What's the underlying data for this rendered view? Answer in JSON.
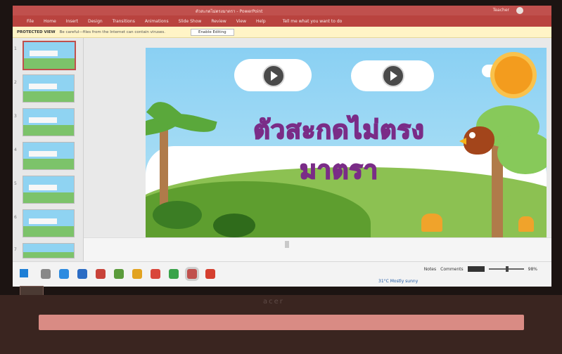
{
  "window": {
    "doc_title": "ตัวสะกดไม่ตรงมาตรา - PowerPoint",
    "user": "Teacher"
  },
  "ribbon": {
    "tabs": [
      "File",
      "Home",
      "Insert",
      "Design",
      "Transitions",
      "Animations",
      "Slide Show",
      "Review",
      "View",
      "Help"
    ],
    "tell_me": "Tell me what you want to do"
  },
  "notice": {
    "label": "PROTECTED VIEW",
    "message": "Be careful—files from the Internet can contain viruses.",
    "button": "Enable Editing"
  },
  "thumbnails": [
    {
      "num": "1"
    },
    {
      "num": "2"
    },
    {
      "num": "3"
    },
    {
      "num": "4"
    },
    {
      "num": "5"
    },
    {
      "num": "6"
    },
    {
      "num": "7"
    }
  ],
  "slide": {
    "title": "ตัวสะกดไม่ตรงมาตรา"
  },
  "statusbar": {
    "notes": "Notes",
    "comments": "Comments",
    "zoom": "98%"
  },
  "taskbar": {
    "weather": "31°C Mostly sunny"
  },
  "device": {
    "brand": "acer"
  },
  "colors": {
    "ribbon": "#b9433f",
    "title_fill": "#f58ad8",
    "title_stroke": "#7a2c87"
  }
}
